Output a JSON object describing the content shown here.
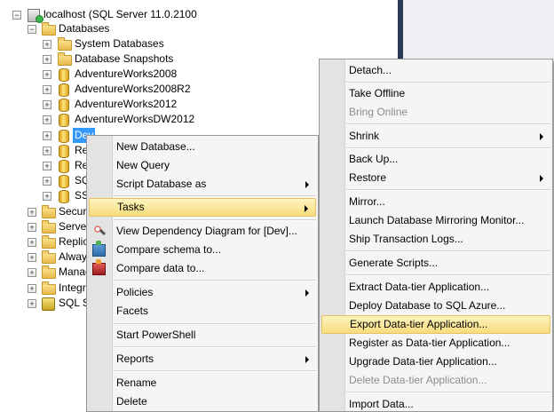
{
  "window": {
    "top_text": ""
  },
  "tree": {
    "server": "localhost (SQL Server 11.0.2100",
    "databases": "Databases",
    "system_databases": "System Databases",
    "database_snapshots": "Database Snapshots",
    "db1": "AdventureWorks2008",
    "db2": "AdventureWorks2008R2",
    "db3": "AdventureWorks2012",
    "db4": "AdventureWorksDW2012",
    "db_selected": "Dev",
    "db6": "Re",
    "db7": "Re",
    "db8": "SQ",
    "db9": "SS",
    "security": "Securi",
    "server_objects": "Server",
    "replication": "Replic",
    "always_on": "Alway",
    "management": "Manag",
    "integration": "Integr",
    "sql_agent": "SQL Se"
  },
  "context_menu": {
    "new_database": "New Database...",
    "new_query": "New Query",
    "script_database_as": "Script Database as",
    "tasks": "Tasks",
    "view_dependency": "View Dependency Diagram for [Dev]...",
    "compare_schema": "Compare schema to...",
    "compare_data": "Compare data to...",
    "policies": "Policies",
    "facets": "Facets",
    "start_powershell": "Start PowerShell",
    "reports": "Reports",
    "rename": "Rename",
    "delete": "Delete"
  },
  "tasks_menu": {
    "detach": "Detach...",
    "take_offline": "Take Offline",
    "bring_online": "Bring Online",
    "shrink": "Shrink",
    "back_up": "Back Up...",
    "restore": "Restore",
    "mirror": "Mirror...",
    "launch_mirroring_monitor": "Launch Database Mirroring Monitor...",
    "ship_transaction_logs": "Ship Transaction Logs...",
    "generate_scripts": "Generate Scripts...",
    "extract_data_tier": "Extract Data-tier Application...",
    "deploy_to_azure": "Deploy Database to SQL Azure...",
    "export_data_tier": "Export Data-tier Application...",
    "register_data_tier": "Register as Data-tier Application...",
    "upgrade_data_tier": "Upgrade Data-tier Application...",
    "delete_data_tier": "Delete Data-tier Application...",
    "import_data": "Import Data..."
  },
  "colors": {
    "selection": "#3399ff",
    "highlight": "#f8dc7c",
    "menu_bg": "#f5f5f5",
    "splitter": "#293955"
  }
}
